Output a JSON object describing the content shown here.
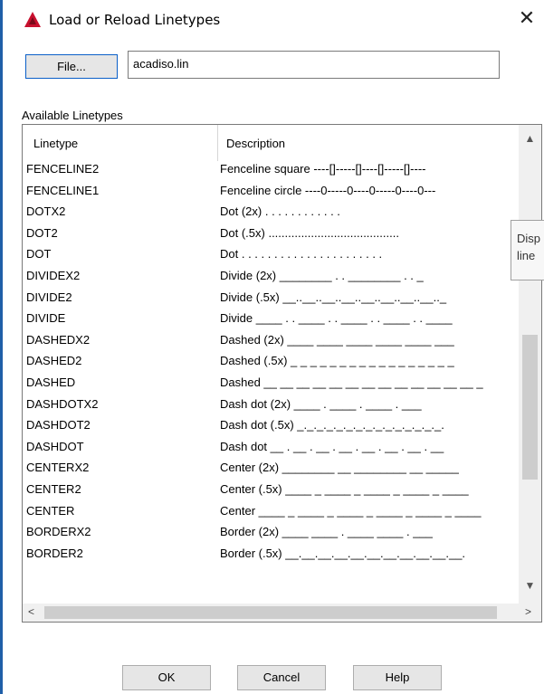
{
  "window": {
    "title": "Load or Reload Linetypes",
    "close_glyph": "✕"
  },
  "file": {
    "button_label": "File...",
    "value": "acadiso.lin"
  },
  "list": {
    "section_label": "Available Linetypes",
    "headers": {
      "linetype": "Linetype",
      "description": "Description"
    },
    "rows": [
      {
        "linetype": "FENCELINE2",
        "description": "Fenceline square ----[]-----[]----[]-----[]----"
      },
      {
        "linetype": "FENCELINE1",
        "description": "Fenceline circle ----0-----0----0-----0----0---"
      },
      {
        "linetype": "DOTX2",
        "description": "Dot (2x) .  .  .  .  .  .  .  .  .  .  .  ."
      },
      {
        "linetype": "DOT2",
        "description": "Dot (.5x) ........................................"
      },
      {
        "linetype": "DOT",
        "description": "Dot . . . . . . . . . . . . . . . . . . . . . ."
      },
      {
        "linetype": "DIVIDEX2",
        "description": "Divide (2x) ________  .  .  ________  .  .  _"
      },
      {
        "linetype": "DIVIDE2",
        "description": "Divide (.5x) __..__..__..__..__..__..__..__.._"
      },
      {
        "linetype": "DIVIDE",
        "description": "Divide ____ . . ____ . . ____ . . ____ . . ____"
      },
      {
        "linetype": "DASHEDX2",
        "description": "Dashed (2x) ____  ____  ____  ____  ____  ___"
      },
      {
        "linetype": "DASHED2",
        "description": "Dashed (.5x) _ _ _ _ _ _ _ _ _ _ _ _ _ _ _ _ _"
      },
      {
        "linetype": "DASHED",
        "description": "Dashed __ __ __ __ __ __ __ __ __ __ __ __ __ _"
      },
      {
        "linetype": "DASHDOTX2",
        "description": "Dash dot (2x) ____  .  ____  .  ____  .  ___"
      },
      {
        "linetype": "DASHDOT2",
        "description": "Dash dot (.5x) _._._._._._._._._._._._._._._."
      },
      {
        "linetype": "DASHDOT",
        "description": "Dash dot __ . __ . __ . __ . __ . __ . __ . __"
      },
      {
        "linetype": "CENTERX2",
        "description": "Center (2x) ________  __  ________  __  _____"
      },
      {
        "linetype": "CENTER2",
        "description": "Center (.5x) ____ _ ____ _ ____ _ ____ _ ____"
      },
      {
        "linetype": "CENTER",
        "description": "Center ____ _ ____ _ ____ _ ____ _ ____ _ ____"
      },
      {
        "linetype": "BORDERX2",
        "description": "Border (2x) ____ ____  .  ____ ____  .  ___"
      },
      {
        "linetype": "BORDER2",
        "description": "Border (.5x) __.__.__.__.__.__.__.__.__.__.__."
      }
    ]
  },
  "tooltip": {
    "line1": "Disp",
    "line2": "line"
  },
  "buttons": {
    "ok": "OK",
    "cancel": "Cancel",
    "help": "Help"
  },
  "icons": {
    "up": "▲",
    "down": "▼",
    "left": "<",
    "right": ">"
  },
  "colors": {
    "accent": "#0a5fc8",
    "app_icon": "#c8102e"
  }
}
